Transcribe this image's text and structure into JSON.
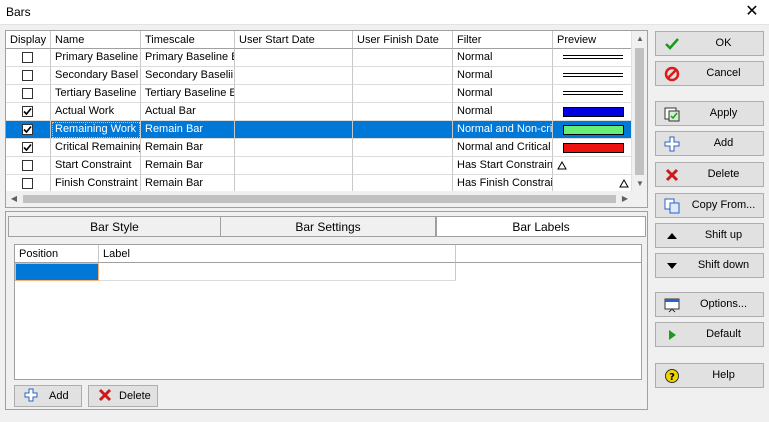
{
  "window": {
    "title": "Bars",
    "close_glyph": "✕"
  },
  "columns": [
    "Display",
    "Name",
    "Timescale",
    "User Start Date",
    "User Finish Date",
    "Filter",
    "Preview"
  ],
  "rows": [
    {
      "display": false,
      "name": "Primary Baseline",
      "timescale": "Primary Baseline B",
      "filter": "Normal",
      "preview": "double-line"
    },
    {
      "display": false,
      "name": "Secondary Basel",
      "timescale": "Secondary Baselii",
      "filter": "Normal",
      "preview": "double-line"
    },
    {
      "display": false,
      "name": "Tertiary Baseline",
      "timescale": "Tertiary Baseline B",
      "filter": "Normal",
      "preview": "double-line"
    },
    {
      "display": true,
      "name": "Actual Work",
      "timescale": "Actual Bar",
      "filter": "Normal",
      "preview": "bar",
      "color": "#0000e0"
    },
    {
      "display": true,
      "name": "Remaining Work",
      "timescale": "Remain Bar",
      "filter": "Normal and Non-cri",
      "preview": "bar",
      "color": "#66ee77",
      "selected": true
    },
    {
      "display": true,
      "name": "Critical Remaining",
      "timescale": "Remain Bar",
      "filter": "Normal and Critical",
      "preview": "bar",
      "color": "#ee1111"
    },
    {
      "display": false,
      "name": "Start Constraint",
      "timescale": "Remain Bar",
      "filter": "Has Start Constrain",
      "preview": "triangle-left"
    },
    {
      "display": false,
      "name": "Finish Constraint",
      "timescale": "Remain Bar",
      "filter": "Has Finish Constrai",
      "preview": "triangle-right"
    }
  ],
  "tabs": [
    {
      "label": "Bar Style",
      "active": false
    },
    {
      "label": "Bar Settings",
      "active": false
    },
    {
      "label": "Bar Labels",
      "active": true
    }
  ],
  "labels_grid": {
    "columns": [
      "Position",
      "Label"
    ]
  },
  "bottom_buttons": {
    "add": "Add",
    "delete": "Delete"
  },
  "side_buttons": [
    {
      "label": "OK",
      "icon": "check-icon"
    },
    {
      "label": "Cancel",
      "icon": "cancel-icon"
    },
    {
      "label": "Apply",
      "icon": "apply-icon"
    },
    {
      "label": "Add",
      "icon": "plus-icon"
    },
    {
      "label": "Delete",
      "icon": "delete-x-icon"
    },
    {
      "label": "Copy From...",
      "icon": "copy-icon"
    },
    {
      "label": "Shift up",
      "icon": "arrow-up-icon"
    },
    {
      "label": "Shift down",
      "icon": "arrow-down-icon"
    },
    {
      "label": "Options...",
      "icon": "options-icon"
    },
    {
      "label": "Default",
      "icon": "play-icon"
    },
    {
      "label": "Help",
      "icon": "help-icon"
    }
  ],
  "colors": {
    "selection": "#0078d7",
    "check": "#1a9c1a",
    "cancel": "#d81b1b",
    "delete": "#cc1a1a",
    "plus": "#2a62c9",
    "help": "#f2d400"
  }
}
